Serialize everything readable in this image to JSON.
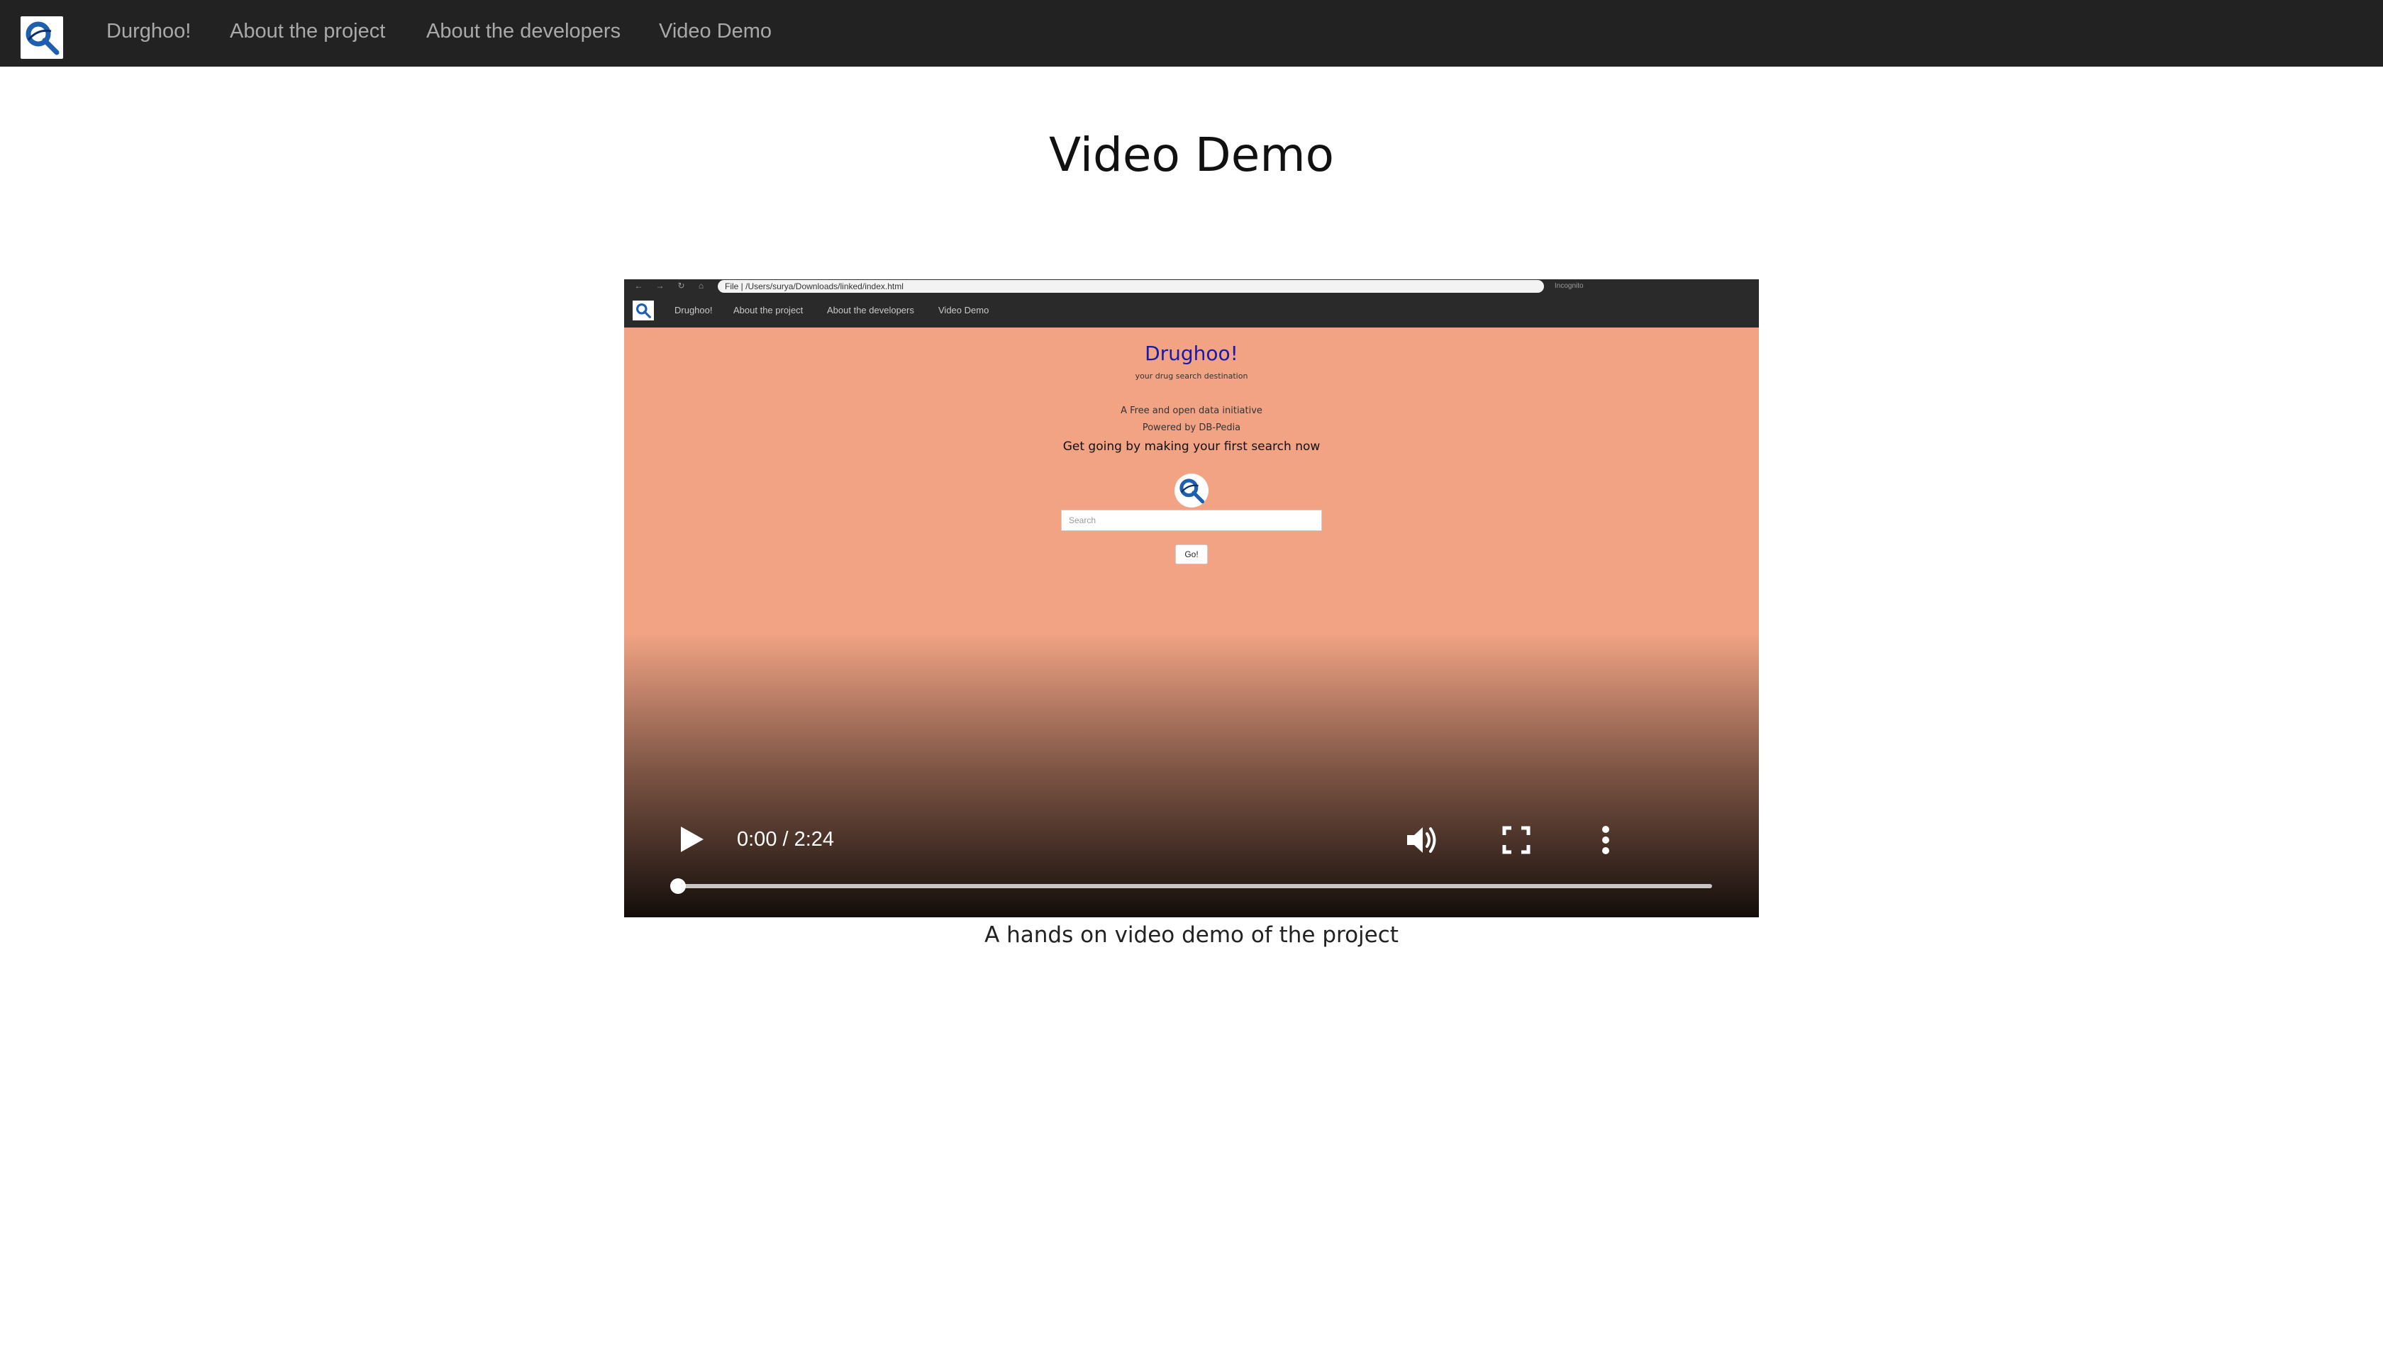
{
  "navbar": {
    "links": [
      {
        "label": "Durghoo!"
      },
      {
        "label": "About the project"
      },
      {
        "label": "About the developers"
      },
      {
        "label": "Video Demo"
      }
    ]
  },
  "page": {
    "title": "Video Demo",
    "caption": "A hands on video demo of the project"
  },
  "video": {
    "time": "0:00 / 2:24",
    "progress": 0,
    "frame": {
      "browser_url": "File | /Users/surya/Downloads/linked/index.html",
      "browser_right_label": "Incognito",
      "nav_links": [
        "Drughoo!",
        "About the project",
        "About the developers",
        "Video Demo"
      ],
      "title": "Drughoo!",
      "subtitle": "your drug search destination",
      "line1": "A Free and open data initiative",
      "line2": "Powered by DB-Pedia",
      "line3": "Get going by making your first search now",
      "search_placeholder": "Search",
      "go_label": "Go!"
    }
  },
  "colors": {
    "navbar_bg": "#222222",
    "nav_link": "#a9a9a9",
    "video_bg": "#f1a384",
    "inner_title": "#1a1aa8",
    "logo_blue": "#1f5fb0"
  }
}
